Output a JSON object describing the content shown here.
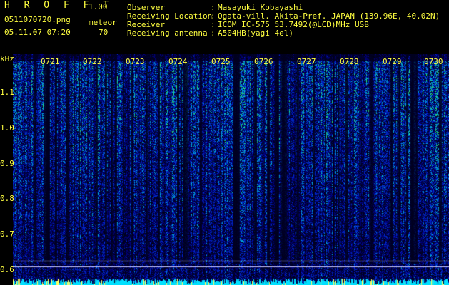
{
  "app": {
    "title": "H R O F F T",
    "version": "1.00"
  },
  "file": {
    "name": "0511070720.png",
    "datetime": "05.11.07 07:20"
  },
  "meteor": {
    "label": "meteor",
    "count": "70"
  },
  "info": [
    {
      "key": "Observer",
      "sep": ":",
      "value": "Masayuki Kobayashi"
    },
    {
      "key": "Receiving Location",
      "sep": ":",
      "value": "Ogata-vill. Akita-Pref. JAPAN (139.96E, 40.02N)"
    },
    {
      "key": "Receiver",
      "sep": ":",
      "value": "ICOM IC-575 53.7492(@LCD)MHz USB"
    },
    {
      "key": "Receiving antenna",
      "sep": ":",
      "value": "A504HB(yagi 4el)"
    }
  ],
  "y_axis": {
    "unit": "kHz",
    "ticks": [
      "1.1",
      "1.0",
      "0.9",
      "0.8",
      "0.7",
      "0.6"
    ]
  },
  "time_labels": [
    "0721",
    "0722",
    "0723",
    "0724",
    "0725",
    "0726",
    "0727",
    "0728",
    "0729",
    "0730"
  ],
  "colors": {
    "text": "#ffff40",
    "bg_spectrum": "#000830",
    "marker_line": "#ffffff",
    "baseline": "#00ffff"
  }
}
